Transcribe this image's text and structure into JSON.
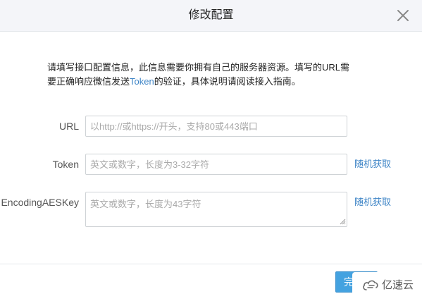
{
  "dialog": {
    "title": "修改配置",
    "close_icon": "close-icon"
  },
  "intro": {
    "part1": "请填写接口配置信息，此信息需要你拥有自己的服务器资源。填写的URL需",
    "part2": "要正确响应微信发送",
    "token_link": "Token",
    "part3": "的验证，具体说明请阅读接入指南。"
  },
  "form": {
    "url": {
      "label": "URL",
      "placeholder": "以http://或https://开头，支持80或443端口",
      "value": ""
    },
    "token": {
      "label": "Token",
      "placeholder": "英文或数字，长度为3-32字符",
      "value": "",
      "random_label": "随机获取"
    },
    "aeskey": {
      "label": "EncodingAESKey",
      "placeholder": "英文或数字，长度为43字符",
      "value": "",
      "random_label": "随机获取"
    }
  },
  "footer": {
    "done_label": "完成"
  },
  "watermark": {
    "text": "亿速云",
    "logo_icon": "cloud-logo-icon"
  },
  "colors": {
    "header_bg": "#f4f5f9",
    "link": "#3d84c6",
    "primary_button": "#44a2e0",
    "placeholder": "#a9a9a9"
  }
}
